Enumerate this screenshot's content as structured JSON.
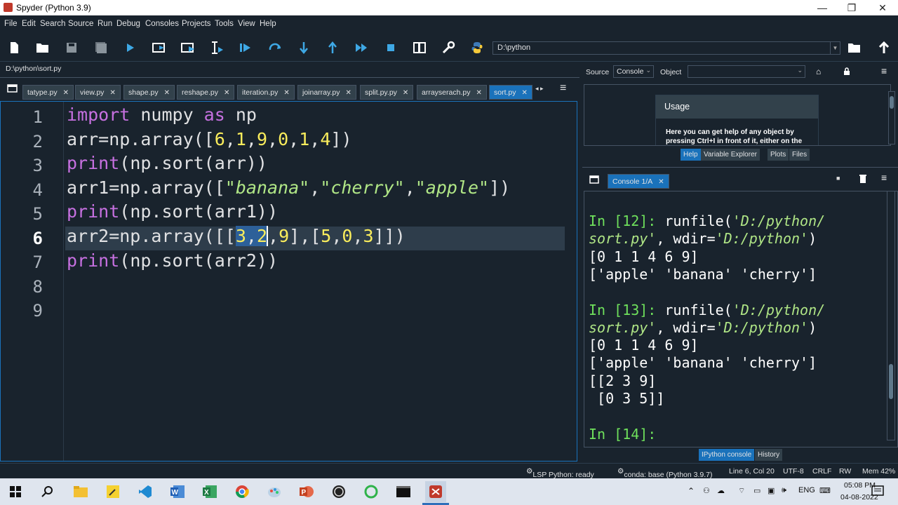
{
  "window": {
    "title": "Spyder (Python 3.9)",
    "minimize": "—",
    "restore": "❐",
    "close": "✕"
  },
  "menu": [
    "File",
    "Edit",
    "Search",
    "Source",
    "Run",
    "Debug",
    "Consoles",
    "Projects",
    "Tools",
    "View",
    "Help"
  ],
  "toolbar": {
    "icons": [
      "new-file-icon",
      "open-file-icon",
      "save-icon",
      "save-all-icon",
      "run-icon",
      "run-cell-icon",
      "run-cell-advance-icon",
      "run-selection-icon",
      "debug-icon",
      "step-over-icon",
      "step-into-icon",
      "step-out-icon",
      "continue-icon",
      "stop-icon",
      "maximize-pane-icon",
      "preferences-icon",
      "python-path-icon"
    ],
    "working_dir": "D:\\python"
  },
  "editor": {
    "file_path": "D:\\python\\sort.py",
    "tabs": [
      {
        "label": "tatype.py",
        "active": false
      },
      {
        "label": "view.py",
        "active": false
      },
      {
        "label": "shape.py",
        "active": false
      },
      {
        "label": "reshape.py",
        "active": false
      },
      {
        "label": "iteration.py",
        "active": false
      },
      {
        "label": "joinarray.py",
        "active": false
      },
      {
        "label": "split.py.py",
        "active": false
      },
      {
        "label": "arrayserach.py",
        "active": false
      },
      {
        "label": "sort.py",
        "active": true
      }
    ],
    "tab_close": "✕",
    "line_numbers": [
      "1",
      "2",
      "3",
      "4",
      "5",
      "6",
      "7",
      "8",
      "9"
    ],
    "current_line": 6,
    "lines": [
      "import numpy as np",
      "arr=np.array([6,1,9,0,1,4])",
      "print(np.sort(arr))",
      "arr1=np.array([\"banana\",\"cherry\",\"apple\"])",
      "print(np.sort(arr1))",
      "arr2=np.array([[3,2,9],[5,0,3]])",
      "print(np.sort(arr2))",
      "",
      ""
    ]
  },
  "help": {
    "source_label": "Source",
    "source_value": "Console",
    "object_label": "Object",
    "usage_title": "Usage",
    "usage_text": "Here you can get help of any object by pressing Ctrl+I in front of it, either on the",
    "tabs": [
      "Help",
      "Variable Explorer",
      "Plots",
      "Files"
    ],
    "active_tab": "Help"
  },
  "console": {
    "tab_label": "Console 1/A",
    "lines": [
      {
        "prompt": "In [12]:",
        "text": " runfile('D:/python/"
      },
      {
        "text": "sort.py', wdir='D:/python')"
      },
      {
        "text": "[0 1 1 4 6 9]"
      },
      {
        "text": "['apple' 'banana' 'cherry']"
      },
      {
        "text": ""
      },
      {
        "prompt": "In [13]:",
        "text": " runfile('D:/python/"
      },
      {
        "text": "sort.py', wdir='D:/python')"
      },
      {
        "text": "[0 1 1 4 6 9]"
      },
      {
        "text": "['apple' 'banana' 'cherry']"
      },
      {
        "text": "[[2 3 9]"
      },
      {
        "text": " [0 3 5]]"
      },
      {
        "text": ""
      },
      {
        "prompt": "In [14]:",
        "text": ""
      }
    ],
    "bottom_tabs": [
      "IPython console",
      "History"
    ],
    "active_bottom_tab": "IPython console"
  },
  "status": {
    "lsp": "LSP Python: ready",
    "conda": "conda: base (Python 3.9.7)",
    "position": "Line 6, Col 20",
    "encoding": "UTF-8",
    "eol": "CRLF",
    "permissions": "RW",
    "memory": "Mem 42%"
  },
  "taskbar": {
    "time": "05:08 PM",
    "date": "04-08-2022",
    "language": "ENG",
    "icons": [
      "windows-start-icon",
      "search-icon",
      "file-explorer-icon",
      "sticky-notes-icon",
      "vscode-icon",
      "word-icon",
      "excel-icon",
      "chrome-icon",
      "paint-icon",
      "powerpoint-icon",
      "obs-icon",
      "app-green-icon",
      "terminal-icon",
      "spyder-icon"
    ]
  },
  "colors": {
    "background": "#19232d",
    "accent": "#1a72bb",
    "keyword": "#c670e0",
    "number": "#faed5c",
    "string": "#b0e686",
    "prompt": "#6fe05c"
  }
}
